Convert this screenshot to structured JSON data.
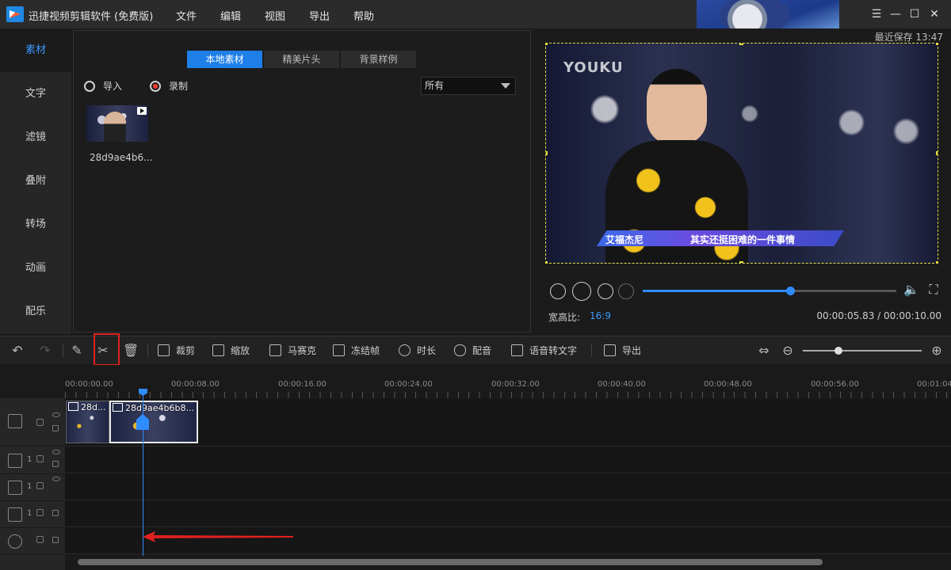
{
  "app": {
    "title": "迅捷视频剪辑软件 (免费版)"
  },
  "menu": [
    "文件",
    "编辑",
    "视图",
    "导出",
    "帮助"
  ],
  "window_controls": [
    "minimize-icon",
    "maximize-icon",
    "close-icon",
    "menu-icon"
  ],
  "autosave": "最近保存 13:47",
  "sidebar": {
    "items": [
      "素材",
      "文字",
      "滤镜",
      "叠附",
      "转场",
      "动画",
      "配乐"
    ],
    "active": 0
  },
  "media": {
    "tabs": [
      "本地素材",
      "精美片头",
      "背景样例"
    ],
    "active_tab": 0,
    "import_label": "导入",
    "record_label": "录制",
    "filter_value": "所有",
    "items": [
      {
        "name": "28d9ae4b6..."
      }
    ]
  },
  "preview": {
    "watermark": "YOUKU",
    "caption_name": "艾福杰尼",
    "caption_text": "其实还挺困难的一件事情",
    "progress": 0.58,
    "aspect_label": "宽高比:",
    "aspect_value": "16:9",
    "timecode": "00:00:05.83 / 00:00:10.00"
  },
  "toolbar": {
    "tools": [
      "裁剪",
      "缩放",
      "马赛克",
      "冻结帧",
      "时长",
      "配音",
      "语音转文字",
      "导出"
    ],
    "zoom_level": 0.3
  },
  "timeline": {
    "ruler": [
      "00:00:00.00",
      "00:00:08.00",
      "00:00:16.00",
      "00:00:24.00",
      "00:00:32.00",
      "00:00:40.00",
      "00:00:48.00",
      "00:00:56.00",
      "00:01:04"
    ],
    "clips": [
      {
        "label": "28d..."
      },
      {
        "label": "28d9ae4b6b8..."
      }
    ],
    "track_numbers": [
      "1",
      "1",
      "1"
    ]
  },
  "colors": {
    "accent": "#2f8cff",
    "highlight": "#e02020",
    "active_tab": "#1e7fe8"
  }
}
